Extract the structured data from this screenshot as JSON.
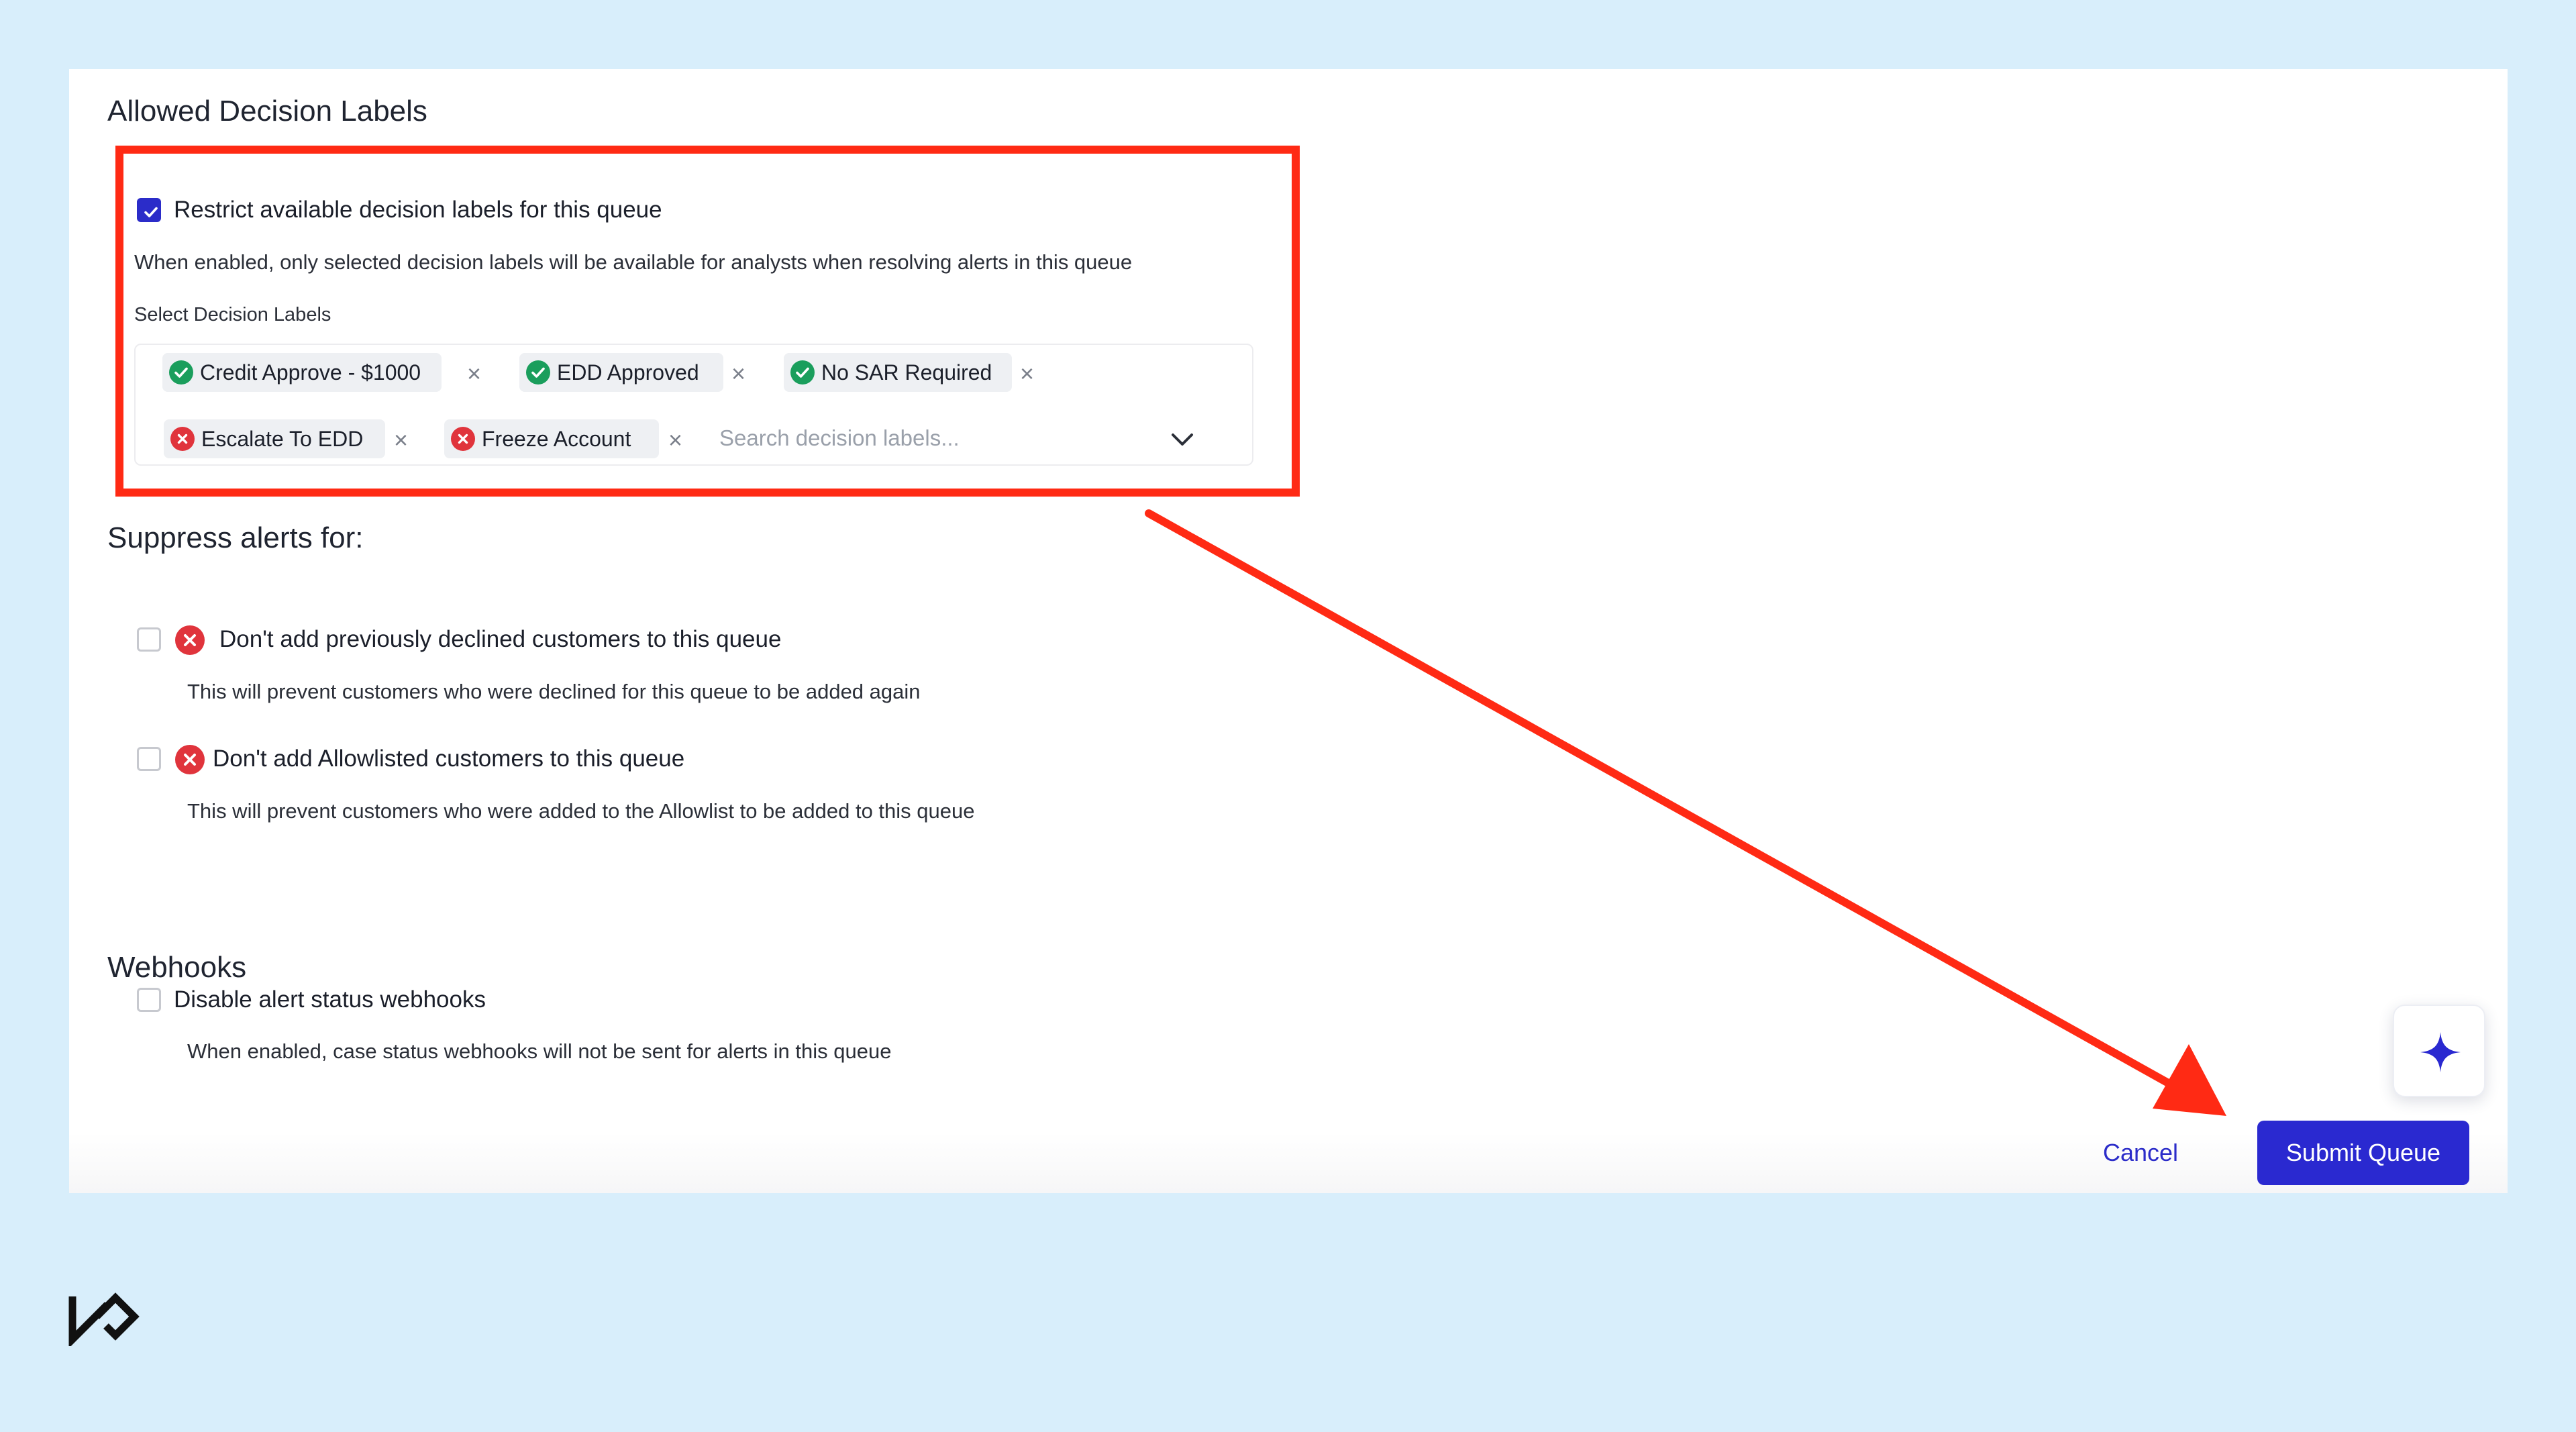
{
  "decision_labels": {
    "heading": "Allowed Decision Labels",
    "restrict_label": "Restrict available decision labels for this queue",
    "restrict_checked": true,
    "restrict_description": "When enabled, only selected decision labels will be available for analysts when resolving alerts in this queue",
    "select_label": "Select Decision Labels",
    "search_placeholder": "Search decision labels...",
    "tags": [
      {
        "label": "Credit Approve - $1000",
        "status": "approved"
      },
      {
        "label": "EDD Approved",
        "status": "approved"
      },
      {
        "label": "No SAR Required",
        "status": "approved"
      },
      {
        "label": "Escalate To EDD",
        "status": "rejected"
      },
      {
        "label": "Freeze Account",
        "status": "rejected"
      }
    ],
    "remove_glyph": "×"
  },
  "suppress": {
    "heading": "Suppress alerts for:",
    "options": [
      {
        "title": "Don't add previously declined customers to this queue",
        "description": "This will prevent customers who were declined for this queue to be added again",
        "checked": false
      },
      {
        "title": "Don't add Allowlisted customers to this queue",
        "description": "This will prevent customers who were added to the Allowlist to be added to this queue",
        "checked": false
      }
    ]
  },
  "webhooks": {
    "heading": "Webhooks",
    "option": {
      "title": "Disable alert status webhooks",
      "description": "When enabled, case status webhooks will not be sent for alerts in this queue",
      "checked": false
    }
  },
  "actions": {
    "cancel_label": "Cancel",
    "submit_label": "Submit Queue"
  },
  "colors": {
    "accent": "#2a29d0",
    "approved": "#1a9e5c",
    "rejected": "#e0343c",
    "highlight": "#ff2a14",
    "page_background": "#d8eefb"
  },
  "icons": {
    "tag_approved": "check-circle-icon",
    "tag_rejected": "x-circle-icon",
    "dropdown": "chevron-down-icon",
    "ai_assistant": "sparkle-icon",
    "brand": "brand-logo-icon"
  }
}
